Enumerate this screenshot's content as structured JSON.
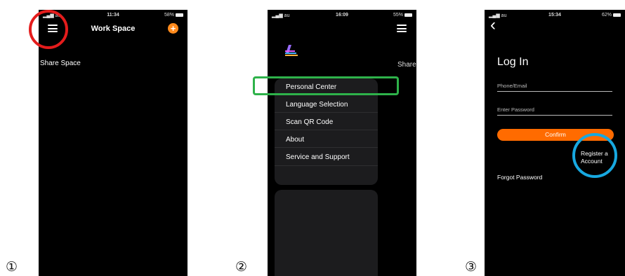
{
  "steps": [
    "①",
    "②",
    "③"
  ],
  "status": {
    "carrier": "au",
    "phone1": {
      "time": "11:34",
      "battery": "58%"
    },
    "phone2": {
      "time": "16:09",
      "battery": "55%"
    },
    "phone3": {
      "time": "15:34",
      "battery": "62%"
    }
  },
  "phone1": {
    "title": "Work Space",
    "share_space": "Share Space",
    "add_label": "+"
  },
  "phone2": {
    "share_peek": "Share",
    "menu": [
      "Personal Center",
      "Language Selection",
      "Scan QR Code",
      "About",
      "Service and Support"
    ]
  },
  "phone3": {
    "back": "‹",
    "title": "Log In",
    "phone_placeholder": "Phone/Email",
    "password_placeholder": "Enter Password",
    "confirm": "Confirm",
    "forgot": "Forgot Password",
    "register_line1": "Register a",
    "register_line2": "Account"
  },
  "colors": {
    "accent_orange": "#ff6b00",
    "highlight_red": "#e41c1c",
    "highlight_green": "#2eb24a",
    "highlight_blue": "#17a8e0"
  }
}
